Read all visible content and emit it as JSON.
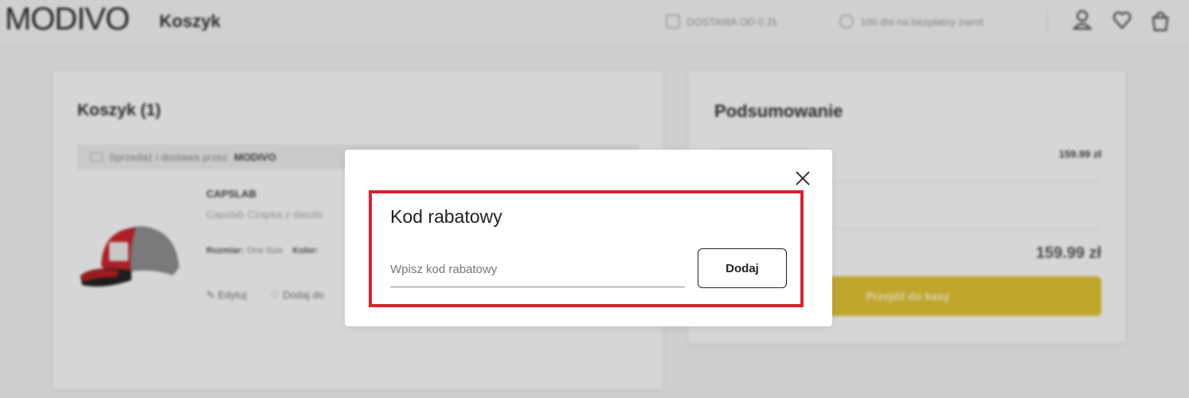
{
  "header": {
    "logo": "MODIVO",
    "title": "Koszyk",
    "delivery_info": "DOSTAWA OD 0 ZŁ",
    "returns_info": "100 dni na bezpłatny zwrot",
    "icons": [
      "user-icon",
      "heart-icon",
      "bag-icon"
    ]
  },
  "cart": {
    "title": "Koszyk (1)",
    "seller_prefix": "Sprzedaż i dostawa przez",
    "seller_name": "MODIVO",
    "product": {
      "brand": "CAPSLAB",
      "name": "Capslab Czapka z daszki",
      "size_label": "Rozmiar:",
      "size_value": "One Size",
      "color_label": "Kolor:",
      "edit_label": "Edytuj",
      "wishlist_label": "Dodaj do",
      "image_colors": {
        "cap": "#c8252c",
        "mesh": "#8e8e8e",
        "patch": "#e9e9e9"
      }
    }
  },
  "summary": {
    "title": "Podsumowanie",
    "subtotal_value": "159.99 zł",
    "total_value": "159.99 zł",
    "checkout_label": "Przejdź do kasy",
    "checkout_color": "#e1c236"
  },
  "modal": {
    "title": "Kod rabatowy",
    "input_placeholder": "Wpisz kod rabatowy",
    "input_value": "",
    "button_label": "Dodaj",
    "highlight_color": "#d9232e"
  }
}
